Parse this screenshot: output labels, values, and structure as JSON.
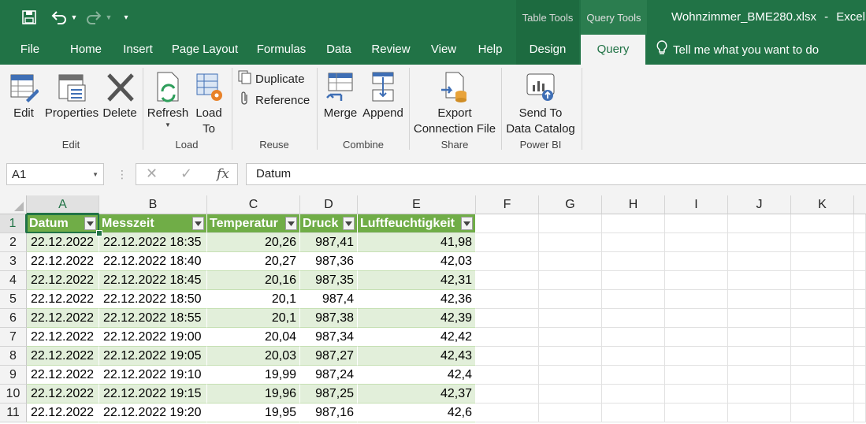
{
  "title": {
    "filename": "Wohnzimmer_BME280.xlsx",
    "separator": "-",
    "app": "Excel",
    "context_groups": [
      "Table Tools",
      "Query Tools"
    ]
  },
  "tabs": [
    {
      "label": "File"
    },
    {
      "label": "Home"
    },
    {
      "label": "Insert"
    },
    {
      "label": "Page Layout"
    },
    {
      "label": "Formulas"
    },
    {
      "label": "Data"
    },
    {
      "label": "Review"
    },
    {
      "label": "View"
    },
    {
      "label": "Help"
    },
    {
      "label": "Design"
    },
    {
      "label": "Query"
    }
  ],
  "tell_me": "Tell me what you want to do",
  "ribbon": {
    "edit_group": {
      "label": "Edit",
      "buttons": [
        "Edit",
        "Properties",
        "Delete"
      ]
    },
    "load_group": {
      "label": "Load",
      "refresh": "Refresh",
      "load_to_1": "Load",
      "load_to_2": "To"
    },
    "reuse_group": {
      "label": "Reuse",
      "duplicate": "Duplicate",
      "reference": "Reference"
    },
    "combine_group": {
      "label": "Combine",
      "merge": "Merge",
      "append": "Append"
    },
    "share_group": {
      "label": "Share",
      "export_1": "Export",
      "export_2": "Connection File"
    },
    "powerbi_group": {
      "label": "Power BI",
      "send_1": "Send To",
      "send_2": "Data Catalog"
    }
  },
  "formula_bar": {
    "name_box": "A1",
    "fx": "fx",
    "value": "Datum"
  },
  "columns": [
    "A",
    "B",
    "C",
    "D",
    "E",
    "F",
    "G",
    "H",
    "I",
    "J",
    "K"
  ],
  "table": {
    "headers": [
      "Datum",
      "Messzeit",
      "Temperatur",
      "Druck",
      "Luftfeuchtigkeit"
    ],
    "rows": [
      [
        "22.12.2022",
        "22.12.2022 18:35",
        "20,26",
        "987,41",
        "41,98"
      ],
      [
        "22.12.2022",
        "22.12.2022 18:40",
        "20,27",
        "987,36",
        "42,03"
      ],
      [
        "22.12.2022",
        "22.12.2022 18:45",
        "20,16",
        "987,35",
        "42,31"
      ],
      [
        "22.12.2022",
        "22.12.2022 18:50",
        "20,1",
        "987,4",
        "42,36"
      ],
      [
        "22.12.2022",
        "22.12.2022 18:55",
        "20,1",
        "987,38",
        "42,39"
      ],
      [
        "22.12.2022",
        "22.12.2022 19:00",
        "20,04",
        "987,34",
        "42,42"
      ],
      [
        "22.12.2022",
        "22.12.2022 19:05",
        "20,03",
        "987,27",
        "42,43"
      ],
      [
        "22.12.2022",
        "22.12.2022 19:10",
        "19,99",
        "987,24",
        "42,4"
      ],
      [
        "22.12.2022",
        "22.12.2022 19:15",
        "19,96",
        "987,25",
        "42,37"
      ],
      [
        "22.12.2022",
        "22.12.2022 19:20",
        "19,95",
        "987,16",
        "42,6"
      ]
    ]
  },
  "row_numbers": [
    "1",
    "2",
    "3",
    "4",
    "5",
    "6",
    "7",
    "8",
    "9",
    "10",
    "11"
  ],
  "colors": {
    "brand": "#217346",
    "table_header": "#70ad47",
    "table_band": "#e2efda"
  }
}
